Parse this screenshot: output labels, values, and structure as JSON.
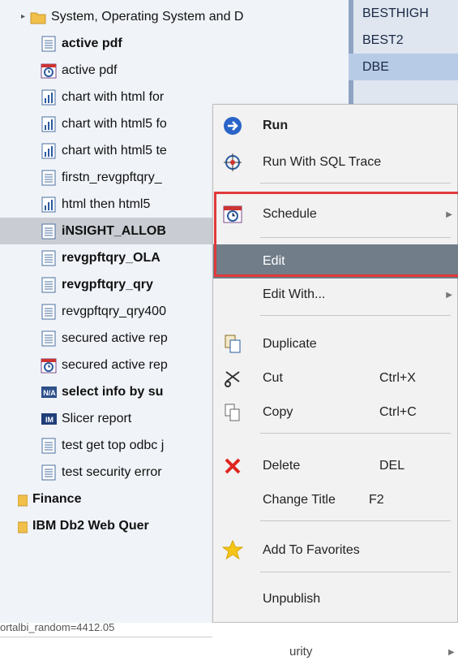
{
  "tree": {
    "items": [
      {
        "label": "System, Operating System and D",
        "icon": "folder-icon",
        "bold": false
      },
      {
        "label": "active pdf",
        "icon": "report-icon",
        "bold": true
      },
      {
        "label": "active pdf",
        "icon": "schedule-icon",
        "bold": false
      },
      {
        "label": "chart with html for",
        "icon": "chart-icon",
        "bold": false
      },
      {
        "label": "chart with html5 fo",
        "icon": "chart-icon",
        "bold": false
      },
      {
        "label": "chart with html5 te",
        "icon": "chart-icon",
        "bold": false
      },
      {
        "label": "firstn_revgpftqry_",
        "icon": "report-icon",
        "bold": false
      },
      {
        "label": "html then html5",
        "icon": "chart-icon",
        "bold": false
      },
      {
        "label": "iNSIGHT_ALLOB",
        "icon": "report-icon",
        "bold": true,
        "selected": true
      },
      {
        "label": "revgpftqry_OLA",
        "icon": "report-icon",
        "bold": true
      },
      {
        "label": "revgpftqry_qry",
        "icon": "report-icon",
        "bold": true
      },
      {
        "label": "revgpftqry_qry400",
        "icon": "report-icon",
        "bold": false
      },
      {
        "label": "secured active rep",
        "icon": "report-icon",
        "bold": false
      },
      {
        "label": "secured active rep",
        "icon": "schedule-icon",
        "bold": false
      },
      {
        "label": "select info by su",
        "icon": "na-icon",
        "bold": true
      },
      {
        "label": "Slicer report",
        "icon": "im-icon",
        "bold": false
      },
      {
        "label": "test get top odbc j",
        "icon": "report-icon",
        "bold": false
      },
      {
        "label": "test security error",
        "icon": "report-icon",
        "bold": false
      },
      {
        "label": "Finance",
        "icon": "folder-icon",
        "bold": true
      },
      {
        "label": "IBM Db2 Web Quer",
        "icon": "folder-icon",
        "bold": true
      }
    ]
  },
  "right_list": {
    "items": [
      "BESTHIGH",
      "BEST2",
      "DBE"
    ]
  },
  "menu": {
    "run": "Run",
    "run_sql_trace": "Run With SQL Trace",
    "schedule": "Schedule",
    "edit": "Edit",
    "edit_with": "Edit With...",
    "duplicate": "Duplicate",
    "cut": "Cut",
    "cut_shortcut": "Ctrl+X",
    "copy": "Copy",
    "copy_shortcut": "Ctrl+C",
    "delete": "Delete",
    "delete_shortcut": "DEL",
    "change_title": "Change Title",
    "change_title_shortcut": "F2",
    "add_to_favorites": "Add To Favorites",
    "unpublish": "Unpublish"
  },
  "below": {
    "url_fragment": "ortalbi_random=4412.05",
    "security_fragment": "urity"
  },
  "colors": {
    "highlight_box": "#e03a3a",
    "active_item": "#727d8a",
    "selected_row": "#c9cdd3"
  }
}
